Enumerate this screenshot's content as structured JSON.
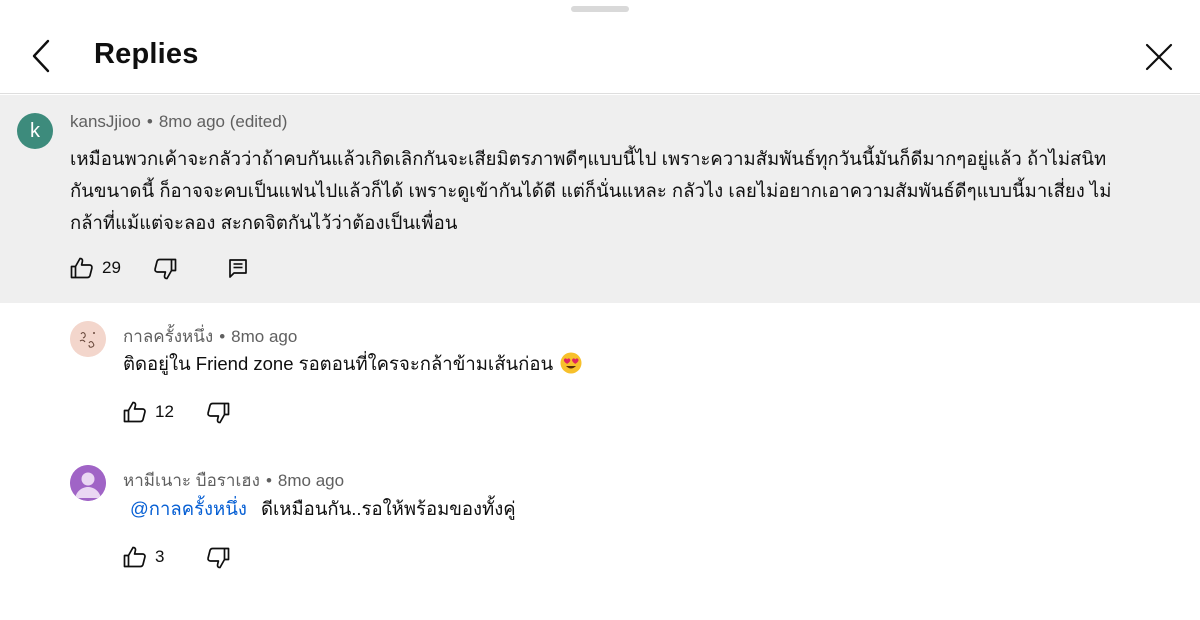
{
  "header": {
    "title": "Replies"
  },
  "parent_comment": {
    "avatar_letter": "k",
    "avatar_color": "#3d8b7c",
    "author": "kansJjioo",
    "time": "8mo ago (edited)",
    "text_lines": [
      "เหมือนพวกเค้าจะกลัวว่าถ้าคบกันแล้วเกิดเลิกกันจะเสียมิตรภาพดีๆแบบนี้ไป เพราะความสัมพันธ์ทุกวันนี้มันก็ดีมากๆอยู่แล้ว ถ้าไม่สนิท",
      "กันขนาดนี้ ก็อาจจะคบเป็นแฟนไปแล้วก็ได้ เพราะดูเข้ากันได้ดี แต่ก็นั่นแหละ กลัวไง เลยไม่อยากเอาความสัมพันธ์ดีๆแบบนี้มาเสี่ยง ไม่",
      "กล้าที่แม้แต่จะลอง สะกดจิตกันไว้ว่าต้องเป็นเพื่อน"
    ],
    "likes": "29"
  },
  "replies": [
    {
      "author": "กาลครั้งหนึ่ง",
      "time": "8mo ago",
      "text": "ติดอยู่ใน Friend zone  รอตอนที่ใครจะกล้าข้ามเส้นก่อน",
      "likes": "12"
    },
    {
      "author": "หามีเนาะ บือราเฮง",
      "time": "8mo ago",
      "mention": "@กาลครั้งหนึ่ง",
      "text": "ดีเหมือนกัน..รอให้พร้อมของทั้งคู่",
      "likes": "3"
    }
  ],
  "separator": "•",
  "colors": {
    "highlight_bg": "#efefef",
    "mention": "#065fd4",
    "meta": "#606060"
  }
}
